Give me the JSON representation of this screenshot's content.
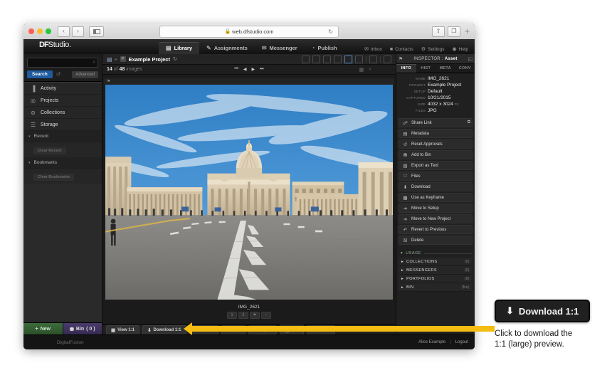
{
  "browser": {
    "url": "web.dfstudio.com",
    "lock_icon": "lock-icon",
    "back_label": "‹",
    "forward_label": "›",
    "reload_icon": "↻",
    "share_icon": "⇧",
    "tabs_icon": "❐",
    "new_tab_label": "+"
  },
  "app": {
    "logo_df": "DF",
    "logo_studio": "Studio.",
    "tabs": [
      {
        "label": "Library",
        "icon": "library-icon",
        "glyph": "▤",
        "active": true
      },
      {
        "label": "Assignments",
        "icon": "assignments-icon",
        "glyph": "✎",
        "active": false
      },
      {
        "label": "Messenger",
        "icon": "messenger-icon",
        "glyph": "✉",
        "active": false
      },
      {
        "label": "Publish",
        "icon": "publish-icon",
        "glyph": "◔",
        "active": false
      }
    ],
    "header_links": [
      {
        "label": "Inbox",
        "icon": "inbox-icon",
        "glyph": "✉"
      },
      {
        "label": "Contacts",
        "icon": "contacts-icon",
        "glyph": "■"
      },
      {
        "label": "Settings",
        "icon": "settings-icon",
        "glyph": "⚙"
      },
      {
        "label": "Help",
        "icon": "help-icon",
        "glyph": "◉"
      }
    ]
  },
  "sidebar": {
    "search_placeholder": "",
    "search_icon": "⌕",
    "search_button": "Search",
    "reset_icon": "↺",
    "advanced_button": "Advanced",
    "nav": [
      {
        "label": "Activity",
        "icon": "activity-icon",
        "glyph": "▐"
      },
      {
        "label": "Projects",
        "icon": "projects-icon",
        "glyph": "◎"
      },
      {
        "label": "Collections",
        "icon": "collections-icon",
        "glyph": "⊜"
      },
      {
        "label": "Storage",
        "icon": "storage-icon",
        "glyph": "☰"
      }
    ],
    "sections": [
      {
        "label": "Recent",
        "clear": "Clear Recent"
      },
      {
        "label": "Bookmarks",
        "clear": "Clear Bookmarks"
      }
    ],
    "new_button": "New",
    "new_icon": "+",
    "bin_button": "Bin",
    "bin_count": "( 0 )",
    "bin_icon": "⛃"
  },
  "center": {
    "breadcrumb_root_icon": "▤",
    "breadcrumb_project_chip": "P",
    "breadcrumb_project": "Example Project",
    "refresh_icon": "↻",
    "count_current": "14",
    "count_of": "of",
    "count_total": "48",
    "count_label": "images",
    "pager": [
      "⏮",
      "◀",
      "▶",
      "⏭"
    ],
    "zoom_icons": [
      "▦",
      "⌕"
    ],
    "view_modes": [
      "filmstrip-view",
      "list-view",
      "grid-small-view",
      "grid-large-view",
      "single-view",
      "compare-view",
      "stack-view",
      "fullscreen-view"
    ],
    "selected_view_index": 4,
    "flag_icon": "⚑",
    "asset_caption": "IMG_2621",
    "rating_buttons": [
      "1",
      "2",
      "⚑",
      "–"
    ],
    "actions": [
      {
        "label": "View 1:1",
        "icon": "view-1-1-icon",
        "glyph": "▣",
        "dim": false
      },
      {
        "label": "Download 1:1",
        "icon": "download-1-1-icon",
        "glyph": "⬇",
        "dim": false
      },
      {
        "label": "Rotate",
        "icon": "rotate-icon",
        "glyph": "↻",
        "dim": true
      },
      {
        "label": "Crop",
        "icon": "crop-icon",
        "glyph": "⌗",
        "dim": true
      },
      {
        "label": "Adjust",
        "icon": "adjust-icon",
        "glyph": "◑",
        "dim": true
      },
      {
        "label": "Info",
        "icon": "info-icon",
        "glyph": "ⓘ",
        "dim": true
      },
      {
        "label": "Share",
        "icon": "share-icon",
        "glyph": "➲",
        "dim": true
      }
    ]
  },
  "inspector": {
    "header_label": "INSPECTOR :",
    "header_value": "Asset",
    "pin_icon": "⚑",
    "collapse_icon": "◱",
    "tabs": [
      {
        "label": "INFO",
        "active": true
      },
      {
        "label": "HIST",
        "active": false
      },
      {
        "label": "META",
        "active": false
      },
      {
        "label": "CONV",
        "active": false
      }
    ],
    "meta": [
      {
        "key": "NAME",
        "value": "IMG_2621",
        "suffix": ""
      },
      {
        "key": "PROJECT",
        "value": "Example Project",
        "suffix": ""
      },
      {
        "key": "SETUP",
        "value": "Default",
        "suffix": ""
      },
      {
        "key": "CAPTURED",
        "value": "10/21/2015",
        "suffix": ""
      },
      {
        "key": "SIZE",
        "value": "4032 x 3024",
        "suffix": "PX"
      },
      {
        "key": "FILES",
        "value": "JPG",
        "suffix": ""
      }
    ],
    "actions": [
      {
        "label": "Share Link",
        "icon": "link-icon",
        "glyph": "☍",
        "tail": "⧉"
      },
      {
        "label": "Metadata",
        "icon": "metadata-icon",
        "glyph": "▤",
        "tail": ""
      },
      {
        "label": "Reset Approvals",
        "icon": "reset-icon",
        "glyph": "↺",
        "tail": ""
      },
      {
        "label": "Add to Bin",
        "icon": "bin-icon",
        "glyph": "⛃",
        "tail": ""
      },
      {
        "label": "Export as Text",
        "icon": "export-icon",
        "glyph": "▧",
        "tail": ""
      },
      {
        "label": "Files",
        "icon": "files-icon",
        "glyph": "□",
        "tail": ""
      },
      {
        "label": "Download",
        "icon": "download-icon",
        "glyph": "⬇",
        "tail": ""
      },
      {
        "label": "Use as Keyframe",
        "icon": "keyframe-icon",
        "glyph": "▩",
        "tail": ""
      },
      {
        "label": "Move to Setup",
        "icon": "move-icon",
        "glyph": "➜",
        "tail": ""
      },
      {
        "label": "Move to New Project",
        "icon": "move-new-icon",
        "glyph": "➜",
        "tail": ""
      },
      {
        "label": "Revert to Previous",
        "icon": "revert-icon",
        "glyph": "↶",
        "tail": ""
      },
      {
        "label": "Delete",
        "icon": "delete-icon",
        "glyph": "☒",
        "tail": ""
      }
    ],
    "usage_title": "USAGE",
    "usage_caret": "▾",
    "usage_rows": [
      {
        "label": "COLLECTIONS",
        "count": "(0)"
      },
      {
        "label": "MESSENGERS",
        "count": "(0)"
      },
      {
        "label": "PORTFOLIOS",
        "count": "(0)"
      },
      {
        "label": "BIN",
        "count": "(No)"
      }
    ]
  },
  "footer": {
    "brand": "DigitalFusion",
    "user": "Alice Example",
    "separator": "|",
    "logout": "Logout"
  },
  "callout": {
    "button_label": "Download 1:1",
    "button_icon": "⬇",
    "description_line1": "Click to download the",
    "description_line2": "1:1 (large) preview."
  },
  "colors": {
    "accent_yellow": "#f5bc11",
    "search_blue": "#1f5b9e",
    "new_green": "#3d6b3a",
    "bin_purple": "#4a3a6b"
  }
}
